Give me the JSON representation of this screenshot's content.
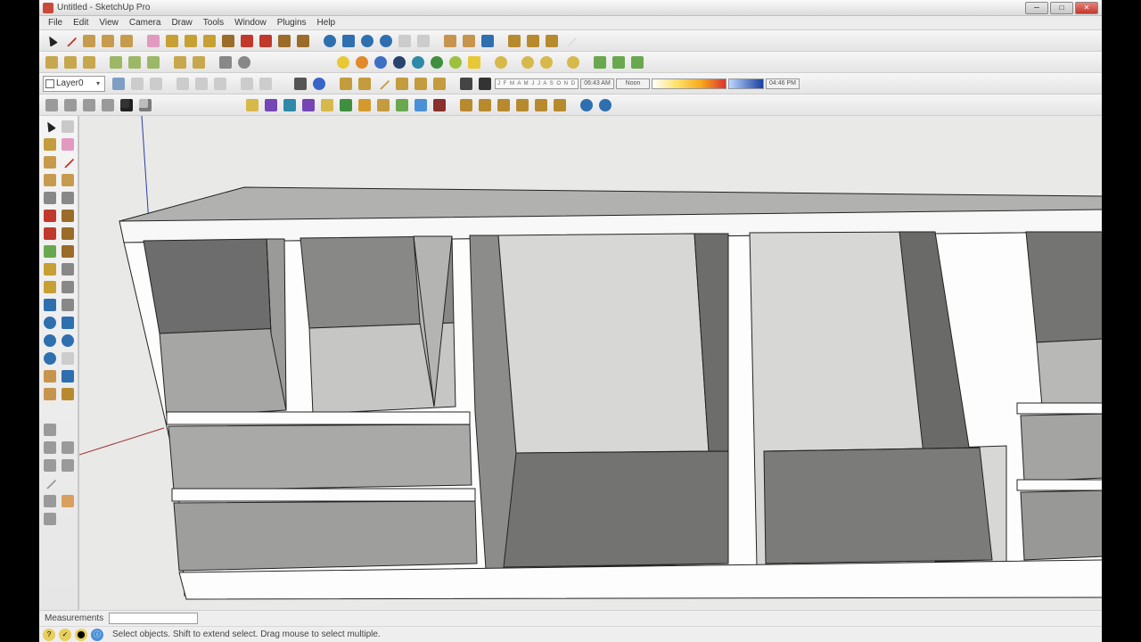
{
  "window": {
    "title": "Untitled - SketchUp Pro",
    "caption": {
      "min": "─",
      "max": "□",
      "close": "✕"
    }
  },
  "menu": [
    "File",
    "Edit",
    "View",
    "Camera",
    "Draw",
    "Tools",
    "Window",
    "Plugins",
    "Help"
  ],
  "layer": {
    "name": "Layer0"
  },
  "shadow": {
    "months": "J F M A M J J A S O N D",
    "noon": "06:43 AM",
    "label": "Noon",
    "time": "04:46 PM"
  },
  "toolbar_rows": [
    {
      "id": "row1",
      "icons": [
        "select-arrow",
        "line",
        "rectangle",
        "circle",
        "arc",
        "",
        "eraser",
        "tape-measure",
        "paint-bucket",
        "protractor",
        "push-pull",
        "move",
        "rotate",
        "follow-me",
        "offset",
        "",
        "orbit",
        "pan",
        "zoom",
        "zoom-extents",
        "prev-view",
        "next-view",
        "",
        "position-camera",
        "look-around",
        "walk",
        "",
        "section-plane",
        "3d-text",
        "layers",
        "outliner"
      ]
    },
    {
      "id": "row2",
      "icons": [
        "new",
        "open",
        "save",
        "",
        "cut",
        "copy",
        "paste",
        "",
        "undo",
        "redo",
        "",
        "print",
        "model-info",
        "",
        "",
        "",
        "",
        "",
        "",
        "",
        "",
        "",
        "",
        "sphere-yellow",
        "sphere-orange",
        "sphere-blue",
        "sphere-navy",
        "sphere-teal",
        "sphere-green",
        "sphere-lime",
        "bulb",
        "",
        "dot1",
        "",
        "dot2",
        "dot3",
        "",
        "dot4",
        "",
        "plugin-a",
        "plugin-b",
        "plugin-c"
      ]
    },
    {
      "id": "row3",
      "left": "layer",
      "icons": [
        "iso",
        "front",
        "back",
        "",
        "left",
        "right",
        "top",
        "",
        "bottom",
        "perspective",
        "",
        "",
        "shadow-toggle",
        "fog",
        "",
        "xray",
        "wireframe",
        "hidden-line",
        "shaded",
        "shaded-tex",
        "mono",
        "",
        "style1",
        "style2"
      ],
      "shadow": true
    },
    {
      "id": "row4",
      "icons": [
        "comp-a",
        "comp-b",
        "comp-c",
        "comp-d",
        "cube-dark",
        "cube-light",
        "",
        "",
        "",
        "",
        "",
        "",
        "",
        "",
        "",
        "",
        "",
        "sandbox-a",
        "sandbox-b",
        "sandbox-c",
        "sandbox-d",
        "sandbox-e",
        "sandbox-f",
        "sandbox-g",
        "sandbox-h",
        "sandbox-i",
        "sandbox-j",
        "sandbox-k",
        "",
        "solid-a",
        "solid-b",
        "solid-c",
        "solid-d",
        "solid-e",
        "solid-f",
        "",
        "help",
        "info"
      ]
    }
  ],
  "left_tool_pairs": [
    [
      "select",
      "component"
    ],
    [
      "paint",
      "eraser2"
    ],
    [
      "rect2",
      "line2"
    ],
    [
      "circle2",
      "arc2"
    ],
    [
      "poly",
      "freehand"
    ],
    [
      "move2",
      "pushpull2"
    ],
    [
      "rotate2",
      "followme2"
    ],
    [
      "scale",
      "offset2"
    ],
    [
      "tape",
      "dimension"
    ],
    [
      "protractor2",
      "text"
    ],
    [
      "axes",
      "3dtext"
    ],
    [
      "orbit2",
      "pan2"
    ],
    [
      "zoom2",
      "zoomwin"
    ],
    [
      "zoomext",
      "previous"
    ],
    [
      "poscam",
      "walk2"
    ],
    [
      "lookaround",
      "section"
    ],
    [
      "",
      ""
    ],
    [
      "getmodel",
      ""
    ],
    [
      "share",
      "upload"
    ],
    [
      "photo",
      "match"
    ],
    [
      "outliner2",
      ""
    ],
    [
      "sandbox2",
      "stamp"
    ],
    [
      "drape",
      ""
    ]
  ],
  "measurements": {
    "label": "Measurements",
    "value": ""
  },
  "status": {
    "geo": [
      {
        "glyph": "?",
        "bg": "#e8cf5b"
      },
      {
        "glyph": "✓",
        "bg": "#e8cf5b"
      },
      {
        "glyph": "⬤",
        "bg": "#e8cf5b"
      }
    ],
    "credit_icon": "ⓘ",
    "hint": "Select objects. Shift to extend select. Drag mouse to select multiple."
  },
  "icon_colors": {
    "select-arrow": "#222",
    "line": "#c0392b",
    "rectangle": "#c79b4d",
    "circle": "#c79b4d",
    "arc": "#c79b4d",
    "eraser": "#e29ac0",
    "tape-measure": "#c7a033",
    "paint-bucket": "#c7a033",
    "protractor": "#c7a033",
    "push-pull": "#9a6b29",
    "move": "#c0392b",
    "rotate": "#c0392b",
    "follow-me": "#9a6b29",
    "offset": "#9a6b29",
    "orbit": "#2e6fb0",
    "pan": "#2e6fb0",
    "zoom": "#2e6fb0",
    "zoom-extents": "#2e6fb0",
    "prev-view": "#ccc",
    "next-view": "#ccc",
    "position-camera": "#c7944d",
    "look-around": "#c7944d",
    "walk": "#2e6fb0",
    "section-plane": "#b88a2e",
    "3d-text": "#b88a2e",
    "layers": "#b88a2e",
    "outliner": "#ddd",
    "new": "#c7a74d",
    "open": "#c7a74d",
    "save": "#c7a74d",
    "cut": "#9cb867",
    "copy": "#9cb867",
    "paste": "#9cb867",
    "undo": "#c7a74d",
    "redo": "#c7a74d",
    "print": "#888",
    "model-info": "#888",
    "sphere-yellow": "#e9c835",
    "sphere-orange": "#e28a2b",
    "sphere-blue": "#3d6fc4",
    "sphere-navy": "#28436f",
    "sphere-teal": "#2e8aa8",
    "sphere-green": "#3f8f3f",
    "sphere-lime": "#9ac23c",
    "bulb": "#e9c835",
    "dot1": "#d7b84b",
    "dot2": "#d7b84b",
    "dot3": "#d7b84b",
    "dot4": "#d7b84b",
    "plugin-a": "#6aa84f",
    "plugin-b": "#6aa84f",
    "plugin-c": "#6aa84f",
    "iso": "#7e9ec4",
    "front": "#ccc",
    "back": "#ccc",
    "left": "#ccc",
    "right": "#ccc",
    "top": "#ccc",
    "bottom": "#ccc",
    "perspective": "#ccc",
    "shadow-toggle": "#555",
    "fog": "#3766c9",
    "xray": "#c49b3d",
    "wireframe": "#c49b3d",
    "hidden-line": "#c49b3d",
    "shaded": "#c49b3d",
    "shaded-tex": "#c49b3d",
    "mono": "#c49b3d",
    "style1": "#444",
    "style2": "#333",
    "comp-a": "#9a9a9a",
    "comp-b": "#9a9a9a",
    "comp-c": "#9a9a9a",
    "comp-d": "#9a9a9a",
    "cube-dark": "#333",
    "cube-light": "#bdbdbd",
    "sandbox-a": "#d7b84b",
    "sandbox-b": "#7646b4",
    "sandbox-c": "#2e8aa8",
    "sandbox-d": "#7646b4",
    "sandbox-e": "#d7b84b",
    "sandbox-f": "#3f8f3f",
    "sandbox-g": "#d49a2e",
    "sandbox-h": "#c49b3d",
    "sandbox-i": "#6aa84f",
    "sandbox-j": "#4a90d9",
    "sandbox-k": "#8a2e2e",
    "solid-a": "#b88a2e",
    "solid-b": "#b88a2e",
    "solid-c": "#b88a2e",
    "solid-d": "#b88a2e",
    "solid-e": "#b88a2e",
    "solid-f": "#b88a2e",
    "help": "#2e6fb0",
    "info": "#2e6fb0",
    "select": "#222",
    "component": "#c9c9c9",
    "paint": "#c49b3d",
    "eraser2": "#e29ac0",
    "rect2": "#c79b4d",
    "line2": "#c0392b",
    "circle2": "#c79b4d",
    "arc2": "#c79b4d",
    "poly": "#888",
    "freehand": "#888",
    "move2": "#c0392b",
    "pushpull2": "#9a6b29",
    "rotate2": "#c0392b",
    "followme2": "#9a6b29",
    "scale": "#6aa84f",
    "offset2": "#9a6b29",
    "tape": "#c7a033",
    "dimension": "#888",
    "protractor2": "#c7a033",
    "text": "#888",
    "axes": "#2e6fb0",
    "3dtext": "#888",
    "orbit2": "#2e6fb0",
    "pan2": "#2e6fb0",
    "zoom2": "#2e6fb0",
    "zoomwin": "#2e6fb0",
    "zoomext": "#2e6fb0",
    "previous": "#ccc",
    "poscam": "#c7944d",
    "walk2": "#2e6fb0",
    "lookaround": "#c7944d",
    "section": "#b88a2e",
    "getmodel": "#9a9a9a",
    "share": "#9a9a9a",
    "upload": "#9a9a9a",
    "photo": "#9a9a9a",
    "match": "#9a9a9a",
    "outliner2": "#9a9a9a",
    "sandbox2": "#9a9a9a",
    "stamp": "#d7a060",
    "drape": "#9a9a9a"
  }
}
